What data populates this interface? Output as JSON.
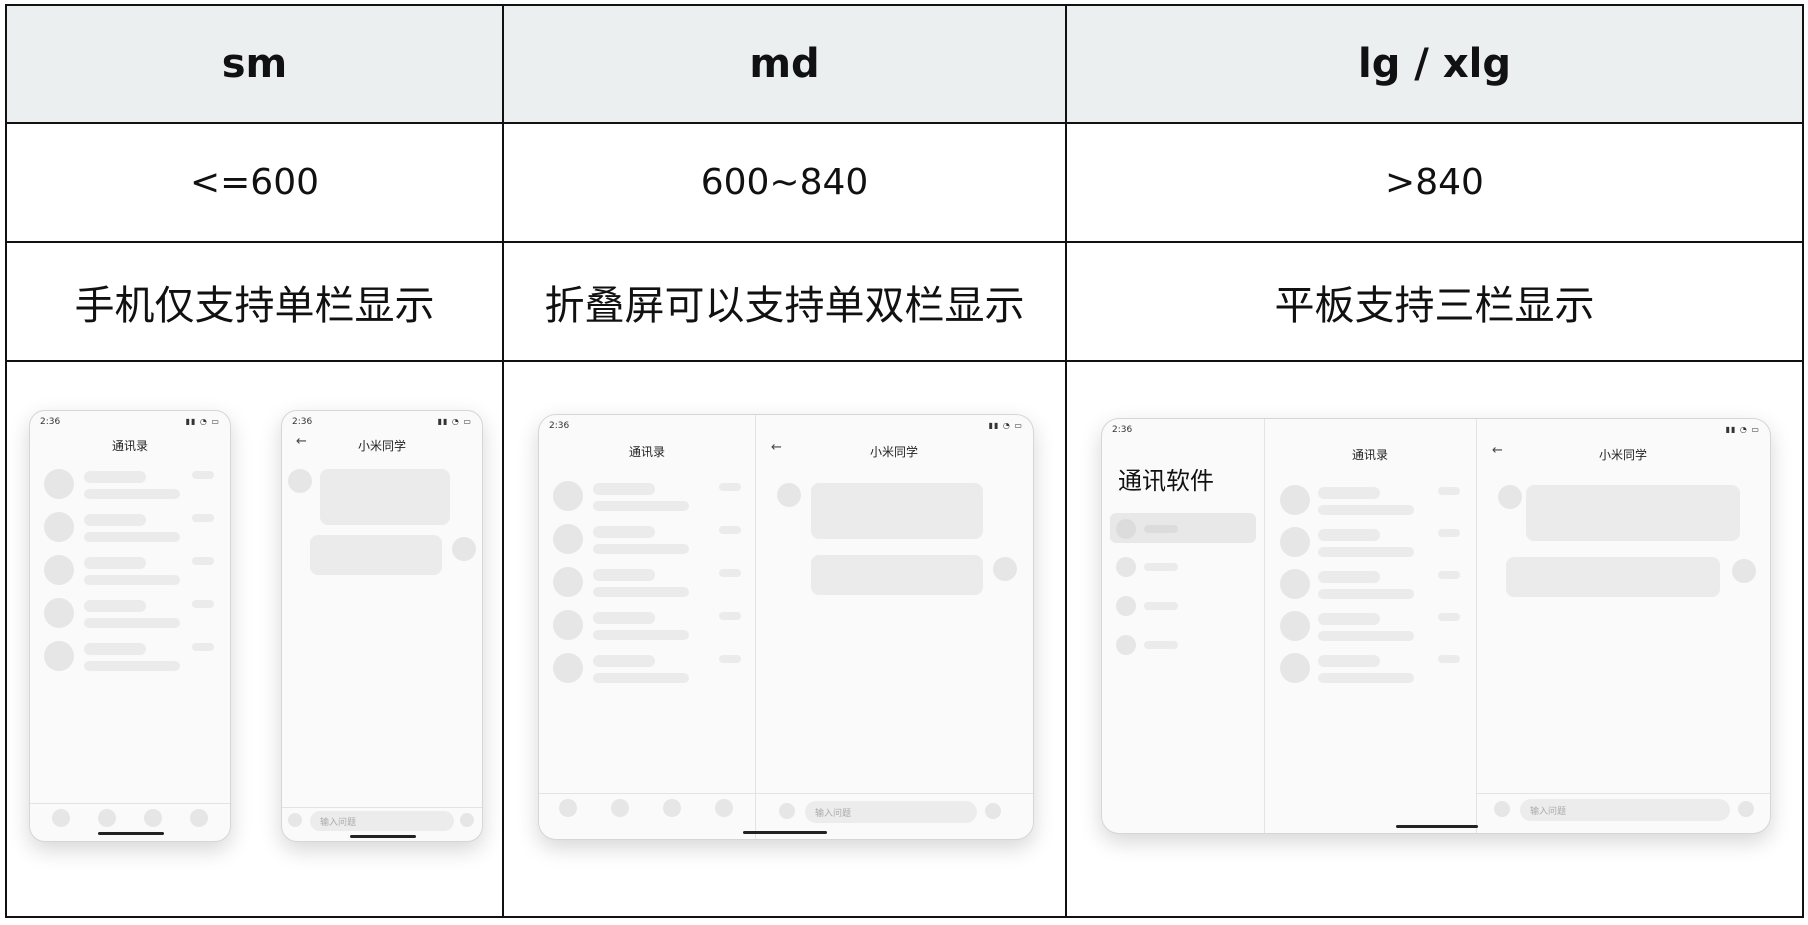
{
  "headers": [
    "sm",
    "md",
    "lg / xlg"
  ],
  "widths": [
    "<=600",
    "600~840",
    ">840"
  ],
  "descriptions": [
    "手机仅支持单栏显示",
    "折叠屏可以支持单双栏显示",
    "平板支持三栏显示"
  ],
  "mockup": {
    "time": "2:36",
    "status_icons": "▮▮ ◔ ▭",
    "contacts_title": "通讯录",
    "chat_title": "小米同学",
    "input_placeholder": "输入问题",
    "app_title": "通讯软件",
    "back_arrow": "←"
  }
}
